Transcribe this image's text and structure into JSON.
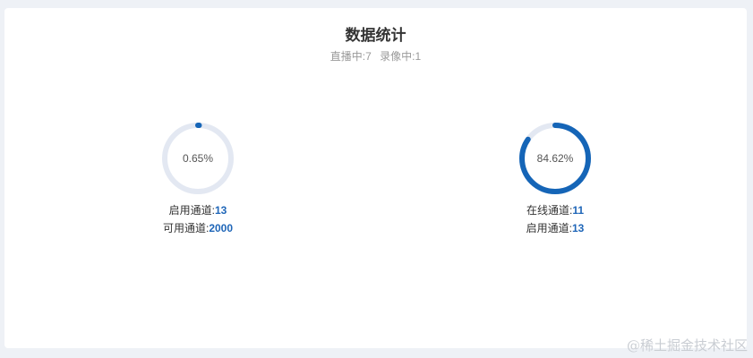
{
  "header": {
    "title": "数据统计",
    "live_label": "直播中:",
    "live_count": "7",
    "record_label": "录像中:",
    "record_count": "1"
  },
  "gauges": [
    {
      "percent_text": "0.65%",
      "progress": 0.0065,
      "line1_label": "启用通道:",
      "line1_value": "13",
      "line2_label": "可用通道:",
      "line2_value": "2000"
    },
    {
      "percent_text": "84.62%",
      "progress": 0.8462,
      "line1_label": "在线通道:",
      "line1_value": "11",
      "line2_label": "启用通道:",
      "line2_value": "13"
    }
  ],
  "colors": {
    "track": "#e3e8f2",
    "progress": "#1565b7"
  },
  "watermark": "@稀土掘金技术社区"
}
